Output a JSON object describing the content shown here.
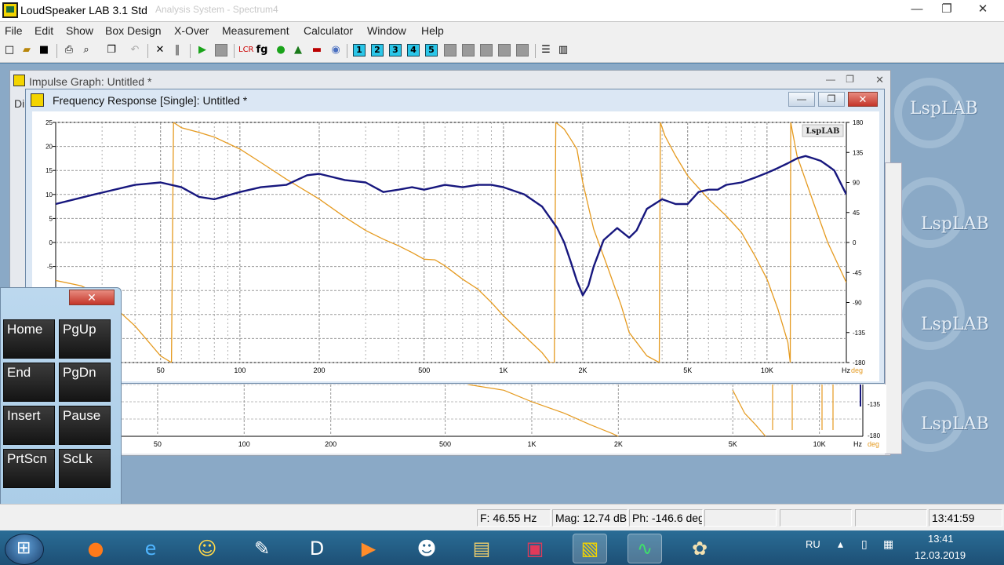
{
  "app": {
    "title": "LoudSpeaker LAB 3.1 Std",
    "ghost_title": "Analysis System - Spectrum4",
    "controls": {
      "minimize": "—",
      "restore": "❐",
      "close": "✕"
    }
  },
  "menu": [
    "File",
    "Edit",
    "Show",
    "Box Design",
    "X-Over",
    "Measurement",
    "Calculator",
    "Window",
    "Help"
  ],
  "toolbar": {
    "numbered": [
      "1",
      "2",
      "3",
      "4",
      "5"
    ],
    "text_buttons": [
      "fg"
    ]
  },
  "impulse_window": {
    "title": "Impulse Graph: Untitled *",
    "tab": "Di"
  },
  "freq_window": {
    "title": "Frequency Response [Single]: Untitled *",
    "controls": {
      "minimize": "—",
      "restore": "❐",
      "close": "✕"
    }
  },
  "watermark": "LspLAB",
  "chart_data": [
    {
      "type": "line",
      "chart": "frequency-response",
      "logo": "LspLAB",
      "x_scale": "log",
      "xlim": [
        20,
        20000
      ],
      "x_ticks": [
        50,
        100,
        200,
        500,
        1000,
        2000,
        5000,
        10000
      ],
      "x_tick_labels": [
        "50",
        "100",
        "200",
        "500",
        "1K",
        "2K",
        "5K",
        "10K"
      ],
      "x_unit": "Hz",
      "y_left": {
        "range": [
          -25,
          25
        ],
        "ticks": [
          25,
          20,
          15,
          10,
          5,
          0,
          -5,
          -10,
          -15,
          -20,
          -25
        ],
        "tick_labels": [
          "25",
          "20",
          "15",
          "10",
          "5",
          "0",
          "-5",
          "",
          "",
          "",
          ""
        ]
      },
      "y_right": {
        "range": [
          -180,
          180
        ],
        "ticks": [
          180,
          135,
          90,
          45,
          0,
          -45,
          -90,
          -135,
          -180
        ],
        "tick_labels": [
          "180",
          "135",
          "90",
          "45",
          "0",
          "-45",
          "-90",
          "-135",
          "-180"
        ],
        "unit": "deg"
      },
      "grid": true,
      "series": [
        {
          "color": "#17177e",
          "axis": "left",
          "x": [
            20,
            28,
            40,
            50,
            60,
            70,
            80,
            100,
            120,
            150,
            180,
            200,
            250,
            300,
            350,
            400,
            450,
            500,
            550,
            600,
            700,
            800,
            900,
            1000,
            1200,
            1400,
            1600,
            1700,
            1800,
            1900,
            2000,
            2100,
            2200,
            2400,
            2700,
            3000,
            3200,
            3500,
            4000,
            4500,
            5000,
            5500,
            6000,
            6500,
            7000,
            8000,
            9000,
            10000,
            11000,
            12000,
            13000,
            14000,
            15000,
            16000,
            17000,
            18000,
            20000
          ],
          "y": [
            8,
            10,
            12,
            12.5,
            11.5,
            9.5,
            9,
            10.5,
            11.5,
            12,
            14,
            14.3,
            13,
            12.5,
            10.5,
            11,
            11.5,
            11,
            11.5,
            12,
            11.5,
            12,
            12,
            11.5,
            10,
            7.5,
            3,
            0,
            -4,
            -8,
            -11,
            -9,
            -5,
            0.5,
            3,
            1,
            2.5,
            7,
            9,
            8,
            8,
            10.5,
            11,
            11,
            12,
            12.5,
            13.5,
            14.5,
            15.5,
            16.5,
            17.5,
            18,
            17.5,
            17,
            16,
            15,
            10
          ]
        },
        {
          "color": "#e59a1f",
          "axis": "right",
          "x": [
            20,
            25,
            30,
            40,
            50,
            55,
            56,
            60,
            70,
            80,
            100,
            120,
            150,
            200,
            250,
            300,
            350,
            400,
            450,
            500,
            550,
            600,
            700,
            800,
            900,
            1000,
            1200,
            1400,
            1500,
            1560,
            1580,
            1700,
            1800,
            1900,
            2000,
            2200,
            2500,
            2800,
            3000,
            3500,
            3900,
            3940,
            4100,
            4500,
            5000,
            6000,
            7000,
            8000,
            9000,
            10000,
            11000,
            12000,
            12250,
            12300,
            13000,
            15000,
            17000,
            20000
          ],
          "y": [
            -57,
            -65,
            -80,
            -125,
            -170,
            -180,
            180,
            172,
            165,
            158,
            140,
            120,
            95,
            65,
            38,
            18,
            5,
            -5,
            -15,
            -25,
            -26,
            -35,
            -55,
            -70,
            -90,
            -110,
            -140,
            -165,
            -180,
            -180,
            180,
            170,
            155,
            140,
            90,
            20,
            -40,
            -95,
            -135,
            -170,
            -180,
            180,
            160,
            130,
            100,
            65,
            40,
            15,
            -20,
            -55,
            -100,
            -150,
            -180,
            180,
            130,
            60,
            0,
            -60
          ]
        }
      ]
    },
    {
      "type": "line",
      "chart": "impulse-graph-background",
      "x_scale": "log",
      "x_ticks": [
        50,
        100,
        200,
        500,
        1000,
        2000,
        5000,
        10000
      ],
      "x_tick_labels": [
        "50",
        "100",
        "200",
        "500",
        "1K",
        "2K",
        "5K",
        "10K"
      ],
      "x_unit": "Hz",
      "y_right": {
        "range": [
          -180,
          180
        ],
        "tick_labels": [
          "-135",
          "-180"
        ],
        "unit": "deg"
      },
      "series": [
        {
          "color": "#e59a1f",
          "axis": "right",
          "x": [
            600,
            800,
            1000,
            1300,
            1600,
            1900,
            2000
          ],
          "y": [
            -90,
            -100,
            -120,
            -140,
            -160,
            -175,
            -180
          ]
        },
        {
          "color": "#e59a1f",
          "axis": "right",
          "x": [
            5000,
            5500,
            6000,
            6500
          ],
          "y": [
            -100,
            -140,
            -160,
            -180
          ]
        }
      ]
    }
  ],
  "keypad": {
    "close_label": "✕",
    "keys": [
      "Home",
      "PgUp",
      "End",
      "PgDn",
      "Insert",
      "Pause",
      "PrtScn",
      "ScLk"
    ]
  },
  "status": {
    "freq": "F: 46.55 Hz",
    "mag": "Mag: 12.74 dB",
    "phase": "Ph: -146.6 deg",
    "time": "13:41:59"
  },
  "taskbar": {
    "lang": "RU",
    "time": "13:41",
    "date": "12.03.2019"
  }
}
